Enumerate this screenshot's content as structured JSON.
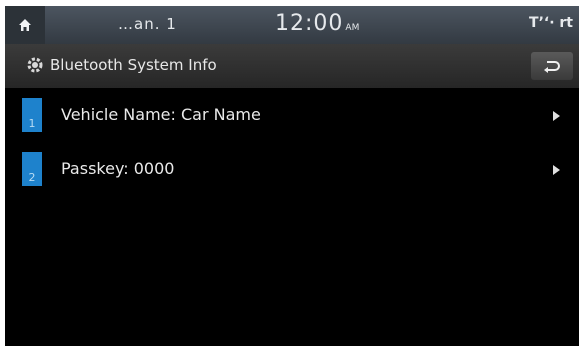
{
  "status_bar": {
    "home_icon": "home-icon",
    "signal_text": "…an. 1",
    "clock": "12:00",
    "ampm": "AM",
    "right_text": "T’ʻ· rt"
  },
  "title_bar": {
    "icon": "bluetooth-gear-icon",
    "title": "Bluetooth System Info",
    "back_icon": "back-arrow-icon"
  },
  "list": {
    "items": [
      {
        "number": "1",
        "label": "Vehicle Name: Car Name"
      },
      {
        "number": "2",
        "label": "Passkey: 0000"
      }
    ]
  },
  "colors": {
    "badge": "#1e82cc",
    "status_bar": "#404850",
    "background": "#000000"
  }
}
